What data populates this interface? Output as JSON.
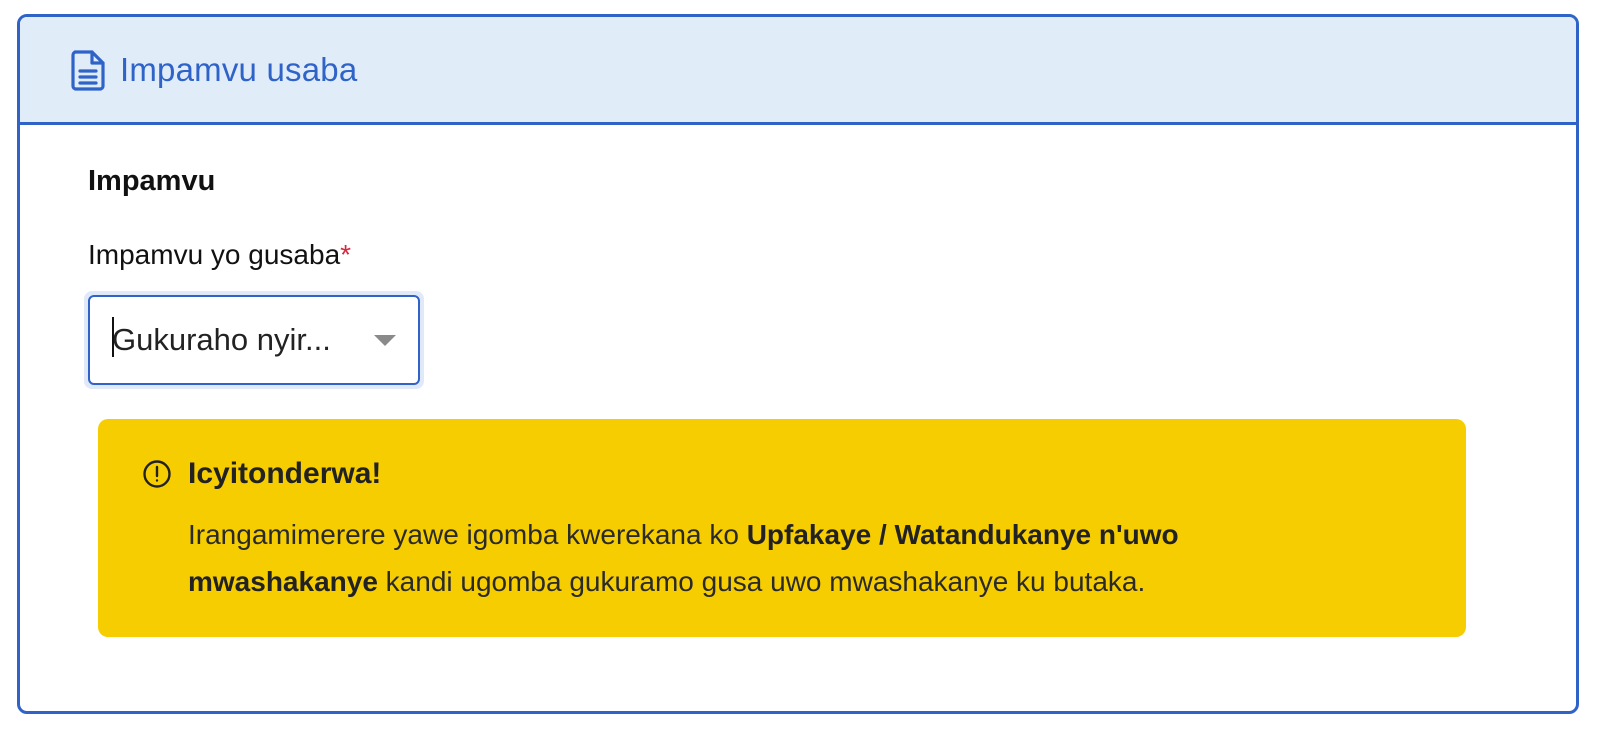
{
  "card": {
    "header_title": "Impamvu usaba",
    "header_icon": "document-icon"
  },
  "section": {
    "title": "Impamvu"
  },
  "reason_field": {
    "label": "Impamvu yo gusaba",
    "required_mark": "*",
    "selected_value": "Gukuraho nyir..."
  },
  "alert": {
    "icon": "exclamation-circle-icon",
    "title": "Icyitonderwa!",
    "text_part1": "Irangamimerere yawe igomba kwerekana ko ",
    "text_bold1": "Upfakaye / Watandukanye n'uwo mwashakanye",
    "text_part2": " kandi ugomba gukuramo gusa uwo mwashakanye ku butaka."
  },
  "colors": {
    "accent": "#2f63c8",
    "header_bg": "#e1ecf9",
    "alert_bg": "#f6cd00",
    "required": "#d8263d"
  }
}
